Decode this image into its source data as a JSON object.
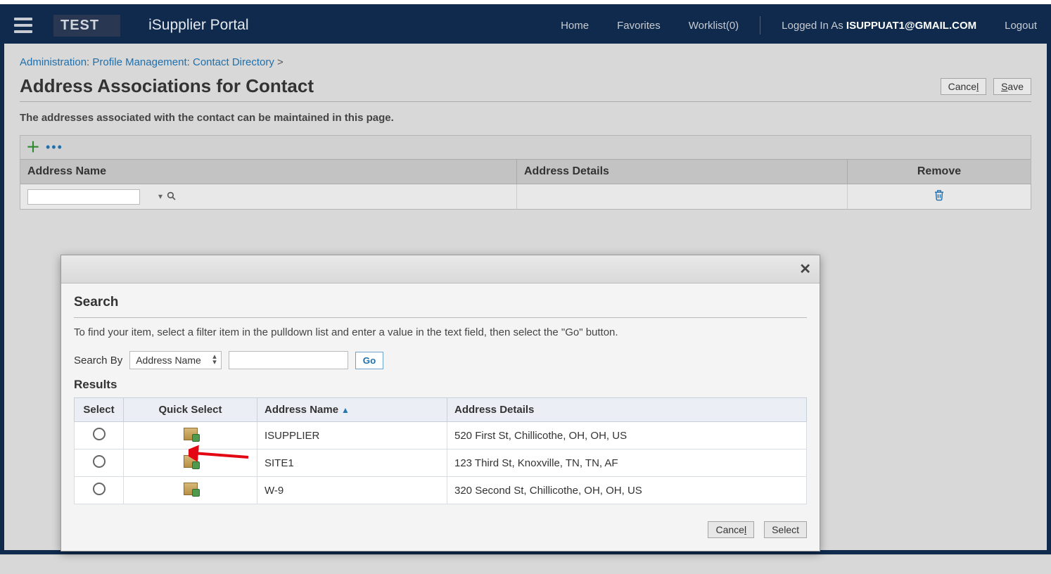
{
  "header": {
    "env_label": "TEST",
    "app_title": "iSupplier Portal",
    "nav_home": "Home",
    "nav_favorites": "Favorites",
    "nav_worklist": "Worklist(0)",
    "logged_in_prefix": "Logged In As ",
    "username": "ISUPPUAT1@GMAIL.COM",
    "logout": "Logout"
  },
  "breadcrumb": {
    "seg1": "Administration",
    "seg2": "Profile Management",
    "seg3": "Contact Directory",
    "sep_colon": ": ",
    "sep_gt": " >"
  },
  "page": {
    "title": "Address Associations for Contact",
    "cancel": "Cancel",
    "cancel_mn": "l",
    "save": "Save",
    "save_mn": "S",
    "description": "The addresses associated with the contact can be maintained in this page."
  },
  "grid": {
    "col_address_name": "Address Name",
    "col_address_details": "Address Details",
    "col_remove": "Remove"
  },
  "dialog": {
    "search_heading": "Search",
    "instructions": "To find your item, select a filter item in the pulldown list and enter a value in the text field, then select the \"Go\" button.",
    "search_by_label": "Search By",
    "search_by_value": "Address Name",
    "go": "Go",
    "results_heading": "Results",
    "th_select": "Select",
    "th_quick_select": "Quick Select",
    "th_address_name": "Address Name",
    "th_address_details": "Address Details",
    "rows": [
      {
        "name": "ISUPPLIER",
        "details": "520 First St, Chillicothe, OH, OH, US"
      },
      {
        "name": "SITE1",
        "details": "123 Third St, Knoxville, TN, TN, AF"
      },
      {
        "name": "W-9",
        "details": "320 Second St, Chillicothe, OH, OH, US"
      }
    ],
    "footer_cancel": "Cancel",
    "footer_cancel_mn": "l",
    "footer_select": "Select"
  }
}
